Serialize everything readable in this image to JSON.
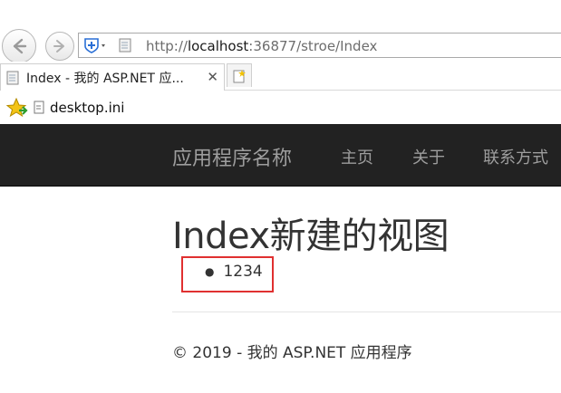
{
  "browser": {
    "url_prefix": "http://",
    "url_host": "localhost",
    "url_rest": ":36877/stroe/Index",
    "tab_title": "Index - 我的 ASP.NET 应...",
    "tab_close": "✕",
    "favorites": [
      {
        "label": "desktop.ini"
      }
    ]
  },
  "site": {
    "brand": "应用程序名称",
    "nav": [
      "主页",
      "关于",
      "联系方式"
    ]
  },
  "main": {
    "heading": "Index新建的视图",
    "list_items": [
      "1234"
    ]
  },
  "footer": {
    "text": "© 2019 - 我的 ASP.NET 应用程序"
  },
  "colors": {
    "navbar_bg": "#222222",
    "nav_text": "#9d9d9d",
    "highlight_border": "#e03030"
  }
}
